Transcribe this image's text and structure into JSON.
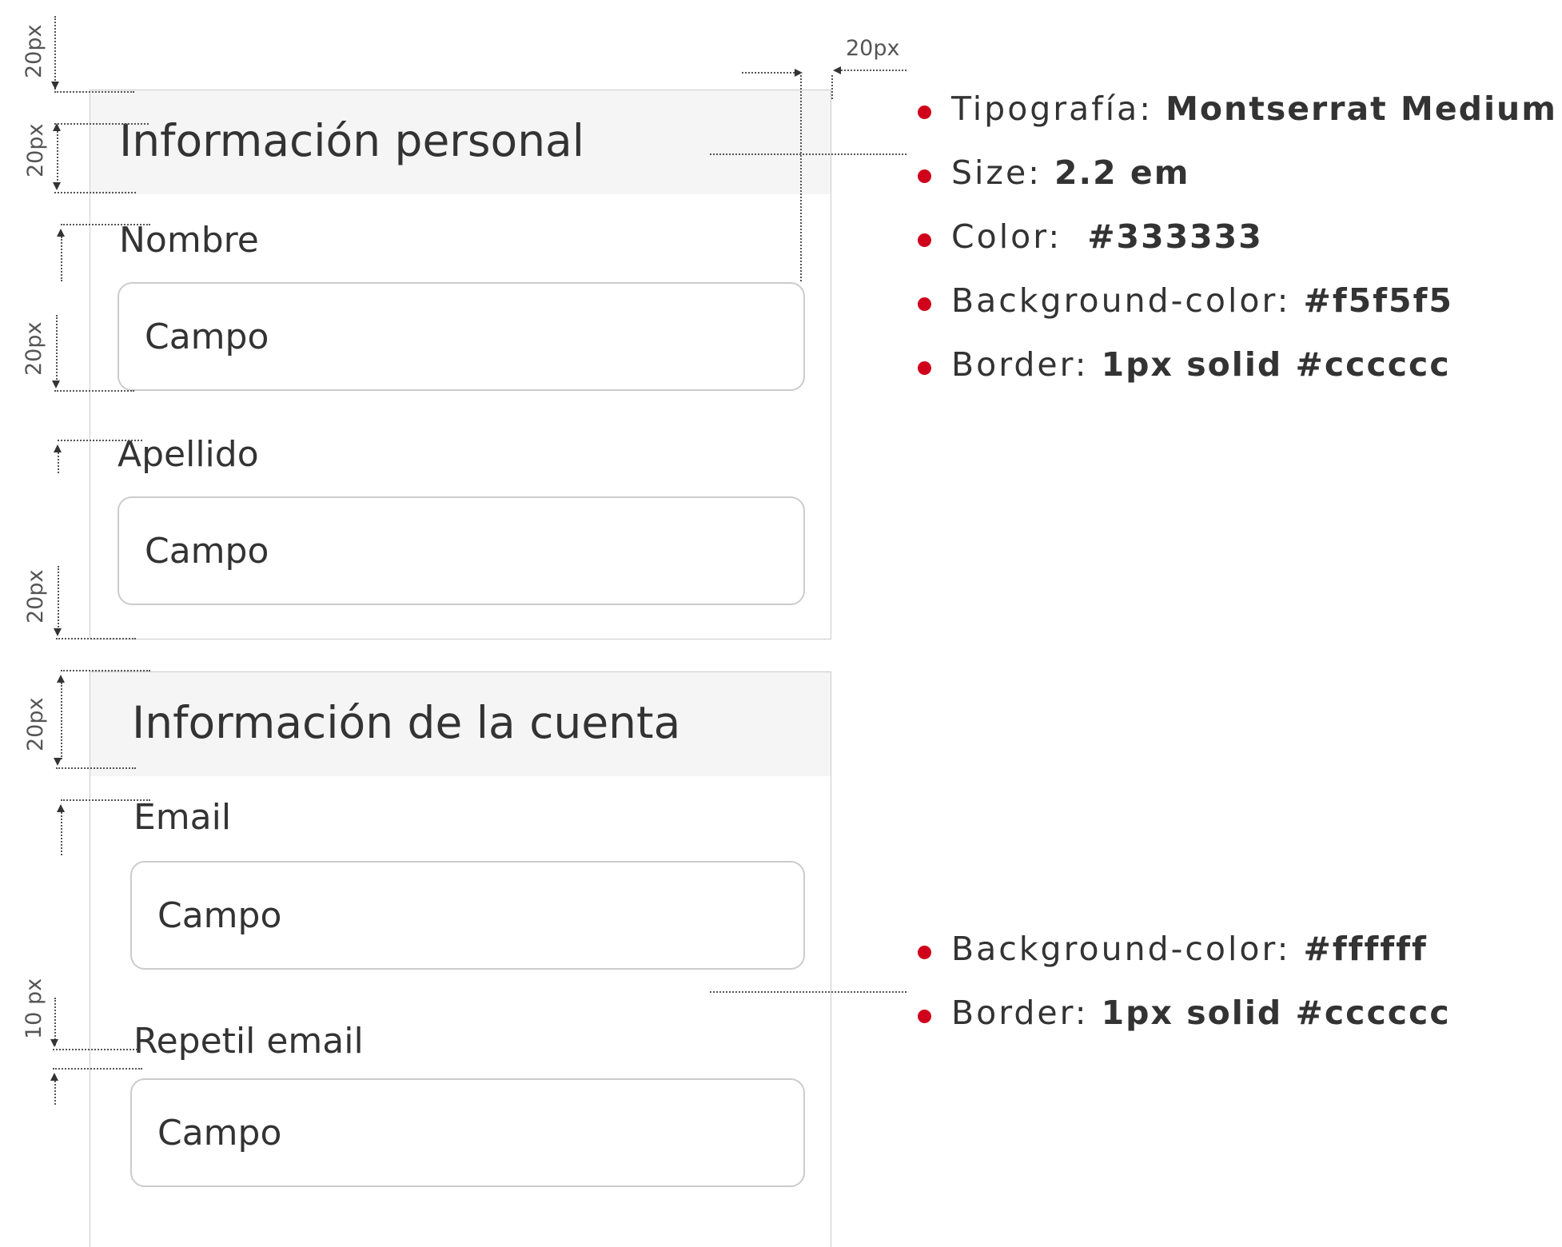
{
  "sections": {
    "personal": {
      "title": "Información personal",
      "fields": [
        {
          "label": "Nombre",
          "placeholder": "Campo"
        },
        {
          "label": "Apellido",
          "placeholder": "Campo"
        }
      ]
    },
    "account": {
      "title": "Información de la cuenta",
      "fields": [
        {
          "label": "Email",
          "placeholder": "Campo"
        },
        {
          "label": "Repetil email",
          "placeholder": "Campo"
        }
      ]
    }
  },
  "measurements": {
    "m20": "20px",
    "m10": "10 px"
  },
  "header_spec": [
    {
      "key": "Tipografía: ",
      "value": "Montserrat Medium"
    },
    {
      "key": "Size: ",
      "value": "2.2 em"
    },
    {
      "key": "Color:  ",
      "value": "#333333"
    },
    {
      "key": "Background-color: ",
      "value": "#f5f5f5"
    },
    {
      "key": "Border: ",
      "value": "1px solid #cccccc"
    }
  ],
  "field_spec": [
    {
      "key": "Background-color: ",
      "value": "#ffffff"
    },
    {
      "key": "Border: ",
      "value": "1px solid #cccccc"
    }
  ],
  "colors": {
    "bullet": "#d0021b",
    "text": "#333333",
    "header_bg": "#f5f5f5",
    "border": "#cccccc"
  }
}
